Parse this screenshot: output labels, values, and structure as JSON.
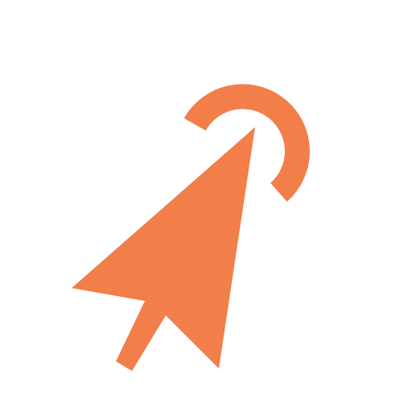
{
  "icon": {
    "name": "cursor-click-icon",
    "parts": [
      "click-ring",
      "arrow-head",
      "arrow-tail"
    ]
  },
  "colors": {
    "background": "#ffffff",
    "accent": "#f27e4a"
  }
}
